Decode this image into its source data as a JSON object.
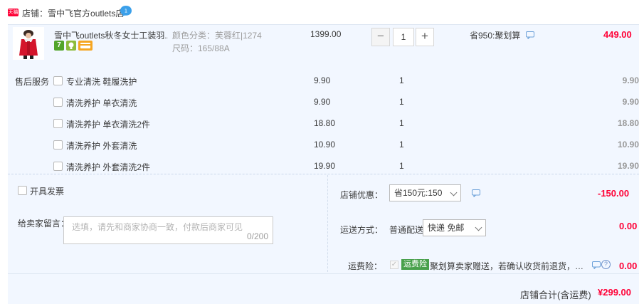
{
  "shop": {
    "badge_text": "天猫",
    "label_prefix": "店铺：",
    "name": "雪中飞官方outlets店"
  },
  "item": {
    "title": "雪中飞outlets秋冬女士工装羽...",
    "sku_color": "颜色分类：芙蓉红|1274",
    "sku_size": "尺码：165/88A",
    "badge_7": "7",
    "price": "1399.00",
    "quantity": "1",
    "minus": "−",
    "plus": "+",
    "promo": "省950:聚划算",
    "subtotal": "449.00"
  },
  "services": {
    "label": "售后服务",
    "rows": [
      {
        "name": "专业清洗 鞋履洗护",
        "price": "9.90",
        "qty": "1",
        "subtotal": "9.90"
      },
      {
        "name": "清洗养护 单衣清洗",
        "price": "9.90",
        "qty": "1",
        "subtotal": "9.90"
      },
      {
        "name": "清洗养护 单衣清洗2件",
        "price": "18.80",
        "qty": "1",
        "subtotal": "18.80"
      },
      {
        "name": "清洗养护 外套清洗",
        "price": "10.90",
        "qty": "1",
        "subtotal": "10.90"
      },
      {
        "name": "清洗养护 外套清洗2件",
        "price": "19.90",
        "qty": "1",
        "subtotal": "19.90"
      }
    ]
  },
  "invoice": {
    "label": "开具发票"
  },
  "message": {
    "label": "给卖家留言：",
    "placeholder": "选填，请先和商家协商一致，付款后商家可见",
    "count": "0/200"
  },
  "discount": {
    "label": "店铺优惠：",
    "selected": "省150元:150",
    "amount": "-150.00"
  },
  "shipping": {
    "label": "运送方式：",
    "method": "普通配送",
    "selected": "快递 免邮",
    "amount": "0.00"
  },
  "insurance": {
    "label": "运费险：",
    "tag": "运费险",
    "text": "聚划算卖家赠送，若确认收货前退货，可获得保险赔付",
    "help": "?",
    "amount": "0.00"
  },
  "total": {
    "label": "店铺合计(含运费)",
    "value": "¥299.00"
  },
  "colors": {
    "accent": "#ff0036",
    "panel": "#f2f7ff",
    "tag_green": "#48a04b"
  }
}
